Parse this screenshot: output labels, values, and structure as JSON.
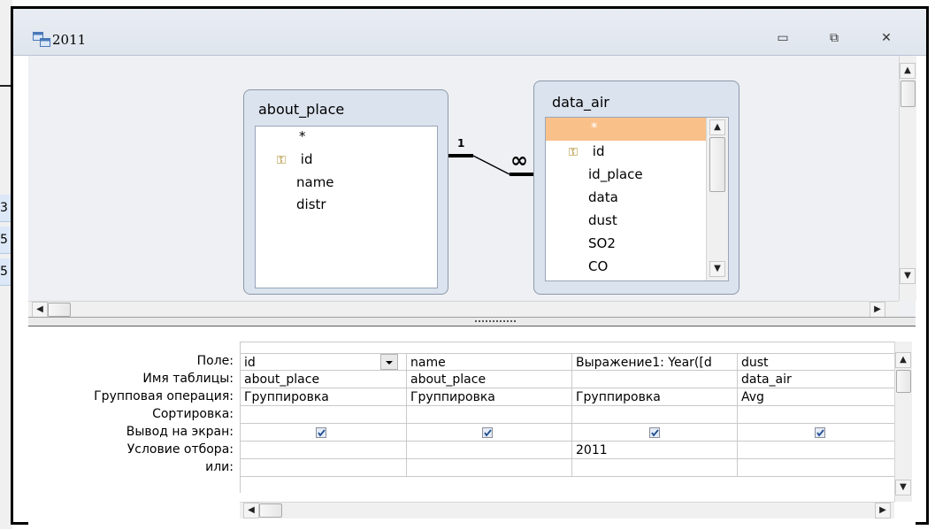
{
  "window": {
    "title": "2011",
    "controls": {
      "minimize": "▭",
      "restore": "⧉",
      "close": "✕"
    }
  },
  "background_fragments": [
    "3",
    "5",
    "5"
  ],
  "tables": [
    {
      "name": "about_place",
      "fields": [
        "*",
        "id",
        "name",
        "distr"
      ],
      "key_field": "id"
    },
    {
      "name": "data_air",
      "fields": [
        "*",
        "id",
        "id_place",
        "data",
        "dust",
        "SO2",
        "CO"
      ],
      "key_field": "id",
      "selected_field": "*"
    }
  ],
  "relationship": {
    "one_label": "1",
    "many_label": "∞"
  },
  "design_grid": {
    "row_labels": [
      "Поле:",
      "Имя таблицы:",
      "Групповая операция:",
      "Сортировка:",
      "Вывод на экран:",
      "Условие отбора:",
      "или:"
    ],
    "columns": [
      {
        "field": "id",
        "table": "about_place",
        "total": "Группировка",
        "sort": "",
        "show": true,
        "criteria": "",
        "or": ""
      },
      {
        "field": "name",
        "table": "about_place",
        "total": "Группировка",
        "sort": "",
        "show": true,
        "criteria": "",
        "or": ""
      },
      {
        "field": "Выражение1: Year([d",
        "table": "",
        "total": "Группировка",
        "sort": "",
        "show": true,
        "criteria": "2011",
        "or": ""
      },
      {
        "field": "dust",
        "table": "data_air",
        "total": "Avg",
        "sort": "",
        "show": true,
        "criteria": "",
        "or": ""
      }
    ]
  },
  "icons": {
    "window_icon": "query-icon",
    "key_icon": "primary-key-icon"
  },
  "colors": {
    "selected_field": "#f9c08a",
    "titlebar": "#e3e8ef",
    "pane_bg": "#eef0f4"
  }
}
